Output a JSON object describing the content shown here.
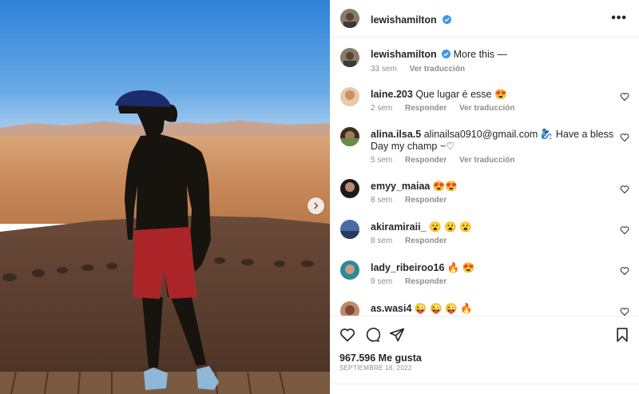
{
  "post": {
    "author": "lewishamilton",
    "more_label": "•••",
    "caption_text": "More this —",
    "caption_time": "33 sem",
    "caption_translate": "Ver traducción",
    "likes": "967.596 Me gusta",
    "date": "SEPTIEMBRE 18, 2022"
  },
  "comments": [
    {
      "user": "laine.203",
      "text": "Que lugar é esse 😍",
      "time": "2 sem",
      "reply": "Responder",
      "translate": "Ver traducción"
    },
    {
      "user": "alina.ilsa.5",
      "text": "alinailsa0910@gmail.com 🧞‍♀️ Have a bless Day my champ ~♡",
      "time": "5 sem",
      "reply": "Responder",
      "translate": "Ver traducción"
    },
    {
      "user": "emyy_maiaa",
      "text": "😍😍",
      "time": "8 sem",
      "reply": "Responder"
    },
    {
      "user": "akiramiraii_",
      "text": "😮 😮 😮",
      "time": "8 sem",
      "reply": "Responder"
    },
    {
      "user": "lady_ribeiroo16",
      "text": "🔥 😍",
      "time": "9 sem",
      "reply": "Responder"
    },
    {
      "user": "as.wasi4",
      "text": "😜 😜 😜 🔥"
    }
  ],
  "colors": {
    "verified": "#3897f0",
    "text": "#262626",
    "muted": "#8e8e8e"
  },
  "icons": {
    "next": "chevron-right-icon",
    "verified": "verified-badge-icon",
    "more": "more-options-icon",
    "like": "heart-icon",
    "comment": "comment-icon",
    "share": "send-icon",
    "save": "bookmark-icon"
  }
}
